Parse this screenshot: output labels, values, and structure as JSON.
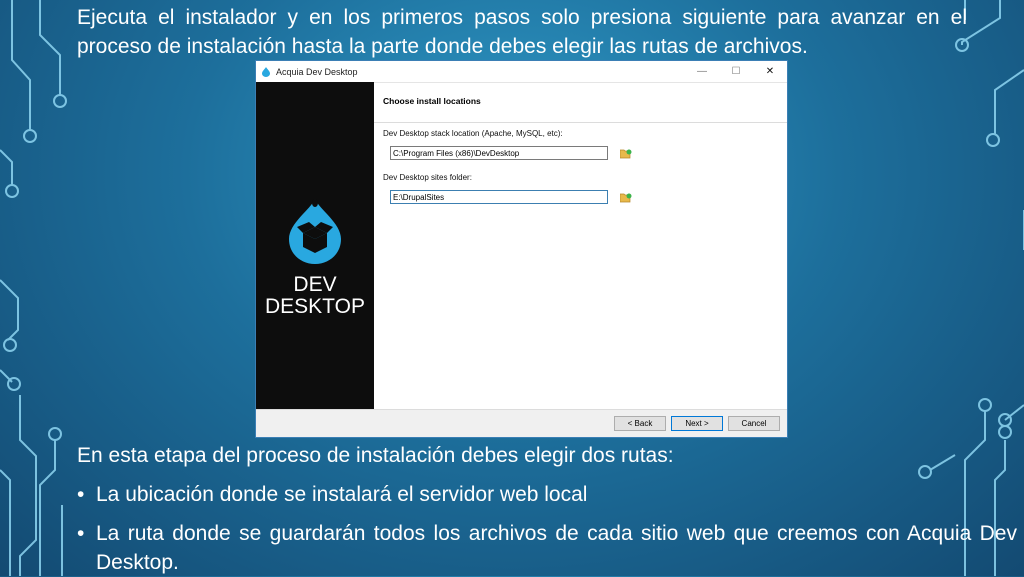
{
  "slide": {
    "intro_line1": "Ejecuta el instalador y en los primeros pasos solo presiona siguiente para avanzar en el",
    "intro_line2": "proceso de instalación hasta la parte donde debes elegir las rutas de archivos.",
    "stage_text": "En esta etapa del proceso de instalación debes elegir dos rutas:",
    "bullet_char": "•",
    "bullets": [
      "La ubicación donde se instalará el servidor web local",
      "La ruta donde se guardarán todos los archivos de cada sitio web que creemos con Acquia Dev Desktop."
    ]
  },
  "dialog": {
    "window_title": "Acquia Dev Desktop",
    "minimize_glyph": "—",
    "maximize_glyph": "☐",
    "close_glyph": "✕",
    "brand_line1": "DEV",
    "brand_line2": "DESKTOP",
    "header_title": "Choose install locations",
    "stack_label": "Dev Desktop stack location (Apache, MySQL, etc):",
    "stack_value": "C:\\Program Files (x86)\\DevDesktop",
    "sites_label": "Dev Desktop sites folder:",
    "sites_value": "E:\\DrupalSites",
    "back_button": "< Back",
    "next_button": "Next >",
    "cancel_button": "Cancel"
  },
  "colors": {
    "drupal_blue": "#29a8e0",
    "background": "#1d6f9c",
    "circuit": "#8fd6f2"
  }
}
